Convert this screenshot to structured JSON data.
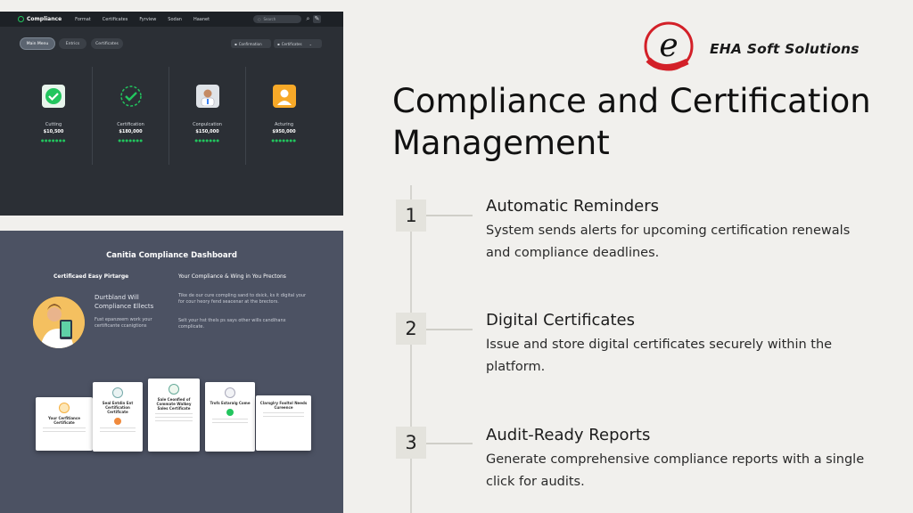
{
  "slide": {
    "title": "Compliance and Certification Management",
    "brand": {
      "name": "EHA Soft Solutions",
      "accent": "#d32028"
    },
    "steps": [
      {
        "number": "1",
        "title": "Automatic Reminders",
        "description": "System sends alerts for upcoming certification renewals and compliance deadlines."
      },
      {
        "number": "2",
        "title": "Digital Certificates",
        "description": "Issue and store digital certificates securely within the platform."
      },
      {
        "number": "3",
        "title": "Audit-Ready Reports",
        "description": "Generate comprehensive compliance reports with a single click for audits."
      }
    ]
  },
  "screenshot_top": {
    "brand": "Compliance",
    "nav": [
      "Format",
      "Certificates",
      "Fyrview",
      "Sodan",
      "Haanet"
    ],
    "search_placeholder": "Search",
    "tabs": [
      "Main Menu",
      "Entrics",
      "Certificates"
    ],
    "pills": [
      "Confirmation",
      "Certificates"
    ],
    "cards": [
      {
        "title": "Cutting",
        "value": "$10,500",
        "icon": "check-shield-icon"
      },
      {
        "title": "Certification",
        "value": "$180,000",
        "icon": "check-circle-icon"
      },
      {
        "title": "Conpulcation",
        "value": "$150,000",
        "icon": "doctor-avatar-icon"
      },
      {
        "title": "Acturing",
        "value": "$950,000",
        "icon": "user-avatar-icon"
      }
    ],
    "rating": "●●●●●●●"
  },
  "screenshot_bottom": {
    "title": "Canitia Compliance Dashboard",
    "heading_left": "Certificaed Easy Pirtarge",
    "heading_right": "Your Compliance & Wing in You Prectons",
    "feature_title": "Durtbland Will Compliance Ellects",
    "feature_desc": "Fust epanzeem work your certificante ccanigtions",
    "right_text_1": "Tike de our cure compling sand to dsick, ks it digital your for cour heory fend seacenar at the brectors.",
    "right_text_2": "Selt your hst thels ps says other wills candihanx complicate.",
    "certificates": [
      "Your Cerfitiance Certificate",
      "Seal Entdin Ent Certification Certificate",
      "Sale Ceonfied of Commate Walkey Sales Certificate",
      "Trofs Estaralg Come",
      "Clarsglry Fooltol Needs Cureence"
    ]
  }
}
